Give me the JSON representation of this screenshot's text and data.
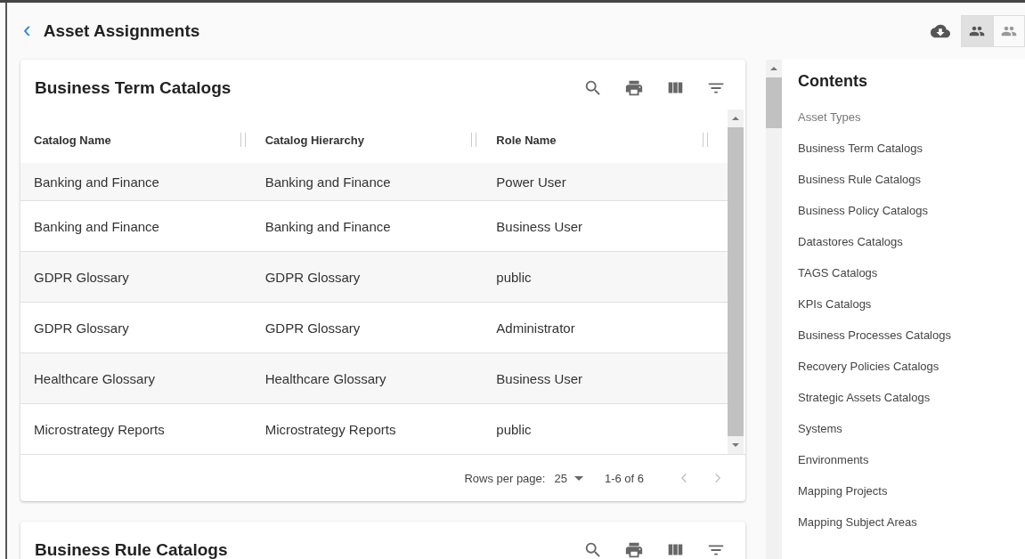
{
  "header": {
    "back": "‹",
    "title": "Asset Assignments",
    "view_toggles": [
      {
        "selected": true
      },
      {
        "selected": false
      }
    ]
  },
  "cards": [
    {
      "title": "Business Term Catalogs",
      "table": {
        "columns": [
          "Catalog Name",
          "Catalog Hierarchy",
          "Role Name"
        ],
        "rows": [
          [
            "Banking and Finance",
            "Banking and Finance",
            "Power User"
          ],
          [
            "Banking and Finance",
            "Banking and Finance",
            "Business User"
          ],
          [
            "GDPR Glossary",
            "GDPR Glossary",
            "public"
          ],
          [
            "GDPR Glossary",
            "GDPR Glossary",
            "Administrator"
          ],
          [
            "Healthcare Glossary",
            "Healthcare Glossary",
            "Business User"
          ],
          [
            "Microstrategy Reports",
            "Microstrategy Reports",
            "public"
          ]
        ]
      },
      "pagination": {
        "rows_label": "Rows per page:",
        "rows_value": "25",
        "range": "1-6 of 6"
      }
    },
    {
      "title": "Business Rule Catalogs"
    }
  ],
  "contents": {
    "title": "Contents",
    "section": "Asset Types",
    "items": [
      "Business Term Catalogs",
      "Business Rule Catalogs",
      "Business Policy Catalogs",
      "Datastores Catalogs",
      "TAGS Catalogs",
      "KPIs Catalogs",
      "Business Processes Catalogs",
      "Recovery Policies Catalogs",
      "Strategic Assets Catalogs",
      "Systems",
      "Environments",
      "Mapping Projects",
      "Mapping Subject Areas"
    ]
  }
}
